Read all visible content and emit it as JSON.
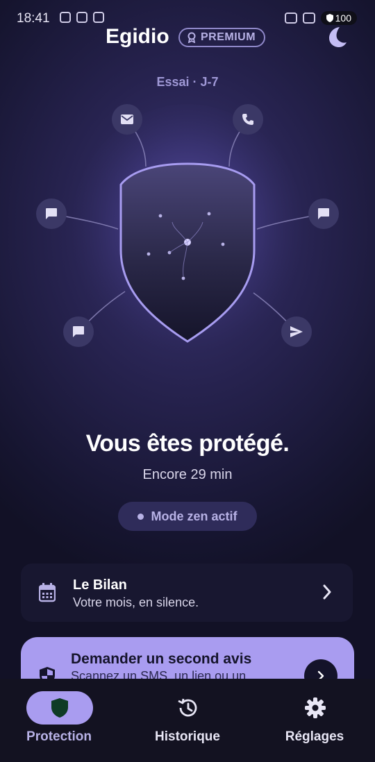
{
  "status": {
    "time": "18:41",
    "battery": "100"
  },
  "header": {
    "title": "Egidio",
    "badge": "PREMIUM"
  },
  "trial": "Essai · J-7",
  "hero": {
    "nodes": [
      "mail-icon",
      "phone-icon",
      "message-icon",
      "message-icon",
      "message-icon",
      "send-icon"
    ]
  },
  "status_text": {
    "headline": "Vous êtes protégé.",
    "remaining": "Encore 29 min",
    "zen": "Mode zen actif"
  },
  "bilan": {
    "title": "Le Bilan",
    "subtitle": "Votre mois, en silence."
  },
  "avis": {
    "title": "Demander un second avis",
    "subtitle": "Scannez un SMS, un lien ou un"
  },
  "nav": {
    "items": [
      {
        "label": "Protection",
        "icon": "shield-icon",
        "active": true
      },
      {
        "label": "Historique",
        "icon": "history-icon",
        "active": false
      },
      {
        "label": "Réglages",
        "icon": "gear-icon",
        "active": false
      }
    ]
  },
  "colors": {
    "accent": "#a99cf0",
    "background": "#221f48",
    "nav": "#131221"
  }
}
